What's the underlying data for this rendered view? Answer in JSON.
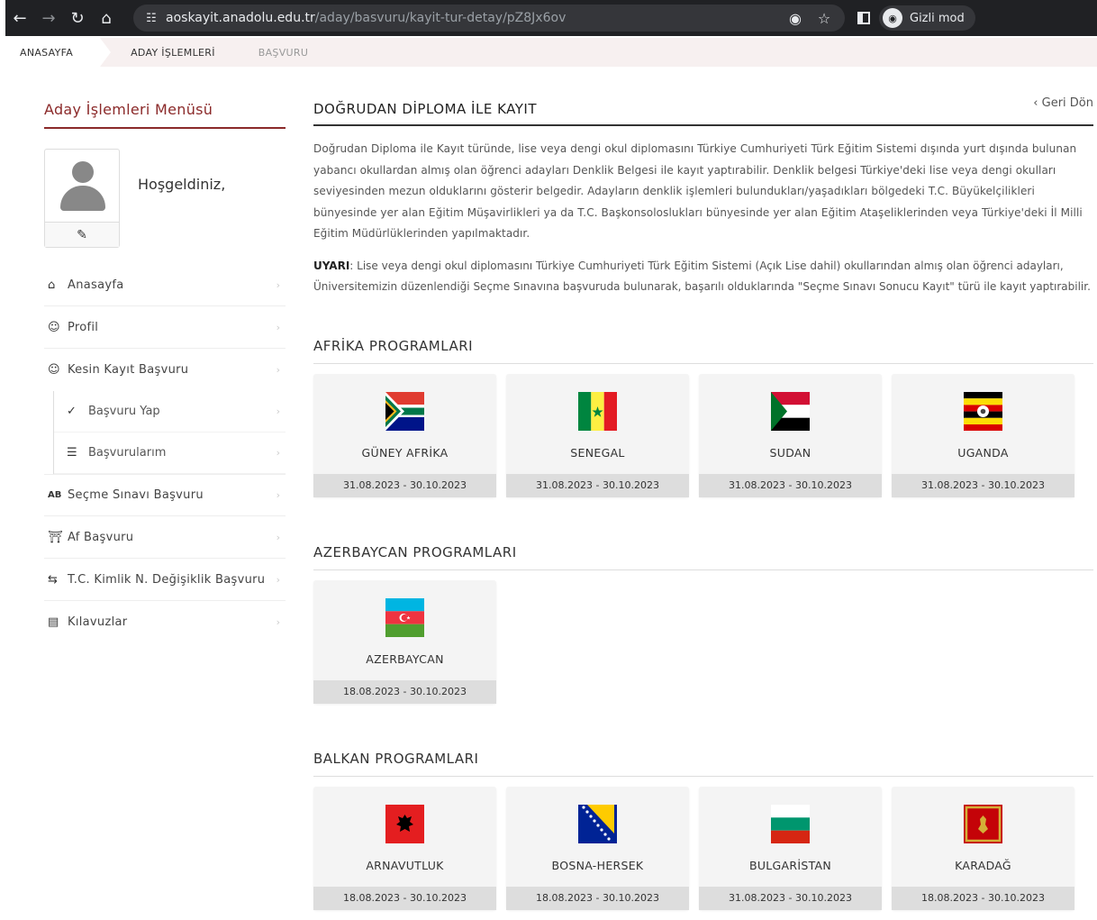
{
  "browser": {
    "url_host": "aoskayit.anadolu.edu.tr",
    "url_path": "/aday/basvuru/kayit-tur-detay/pZ8Jx6ov",
    "incognito_label": "Gizli mod"
  },
  "breadcrumb": [
    "ANASAYFA",
    "ADAY İŞLEMLERİ",
    "BAŞVURU"
  ],
  "sidebar": {
    "title": "Aday İşlemleri Menüsü",
    "welcome": "Hoşgeldiniz,",
    "items": [
      {
        "label": "Anasayfa",
        "icon": "home-icon"
      },
      {
        "label": "Profil",
        "icon": "user-icon"
      },
      {
        "label": "Kesin Kayıt Başvuru",
        "icon": "user-check-icon"
      },
      {
        "label": "Başvuru Yap",
        "icon": "check-icon"
      },
      {
        "label": "Başvurularım",
        "icon": "list-icon"
      },
      {
        "label": "Seçme Sınavı Başvuru",
        "icon": "spellcheck-icon"
      },
      {
        "label": "Af Başvuru",
        "icon": "institution-icon"
      },
      {
        "label": "T.C. Kimlik N. Değişiklik Başvuru",
        "icon": "exchange-icon"
      },
      {
        "label": "Kılavuzlar",
        "icon": "books-icon"
      }
    ]
  },
  "main": {
    "title": "DOĞRUDAN DİPLOMA İLE KAYIT",
    "back": "Geri Dön",
    "description": "Doğrudan Diploma ile Kayıt türünde, lise veya dengi okul diplomasını Türkiye Cumhuriyeti Türk Eğitim Sistemi dışında yurt dışında bulunan yabancı okullardan almış olan öğrenci adayları Denklik Belgesi ile kayıt yaptırabilir. Denklik belgesi Türkiye'deki lise veya dengi okulları seviyesinden mezun olduklarını gösterir belgedir. Adayların denklik işlemleri bulundukları/yaşadıkları bölgedeki T.C. Büyükelçilikleri bünyesinde yer alan Eğitim Müşavirlikleri ya da T.C. Başkonsoloslukları bünyesinde yer alan Eğitim Ataşeliklerinden veya Türkiye'deki İl Milli Eğitim Müdürlüklerinden yapılmaktadır.",
    "warning_label": "UYARI",
    "warning_text": ": Lise veya dengi okul diplomasını Türkiye Cumhuriyeti Türk Eğitim Sistemi (Açık Lise dahil) okullarından almış olan öğrenci adayları, Üniversitemizin düzenlendiği Seçme Sınavına başvuruda bulunarak, başarılı olduklarında \"Seçme Sınavı Sonucu Kayıt\" türü ile kayıt yaptırabilir."
  },
  "sections": [
    {
      "title": "AFRİKA PROGRAMLARI",
      "cards": [
        {
          "name": "GÜNEY AFRİKA",
          "dates": "31.08.2023 - 30.10.2023",
          "flag": "south-africa"
        },
        {
          "name": "SENEGAL",
          "dates": "31.08.2023 - 30.10.2023",
          "flag": "senegal"
        },
        {
          "name": "SUDAN",
          "dates": "31.08.2023 - 30.10.2023",
          "flag": "sudan"
        },
        {
          "name": "UGANDA",
          "dates": "31.08.2023 - 30.10.2023",
          "flag": "uganda"
        }
      ]
    },
    {
      "title": "AZERBAYCAN PROGRAMLARI",
      "cards": [
        {
          "name": "AZERBAYCAN",
          "dates": "18.08.2023 - 30.10.2023",
          "flag": "azerbaijan"
        }
      ]
    },
    {
      "title": "BALKAN PROGRAMLARI",
      "cards": [
        {
          "name": "ARNAVUTLUK",
          "dates": "18.08.2023 - 30.10.2023",
          "flag": "albania"
        },
        {
          "name": "BOSNA-HERSEK",
          "dates": "18.08.2023 - 30.10.2023",
          "flag": "bosnia"
        },
        {
          "name": "BULGARİSTAN",
          "dates": "31.08.2023 - 30.10.2023",
          "flag": "bulgaria"
        },
        {
          "name": "KARADAĞ",
          "dates": "18.08.2023 - 30.10.2023",
          "flag": "montenegro"
        }
      ]
    }
  ],
  "colors": {
    "accent": "#8b2a2a",
    "browser_dark": "#202124",
    "card_bg": "#f4f4f4",
    "date_bar": "#dddddd"
  }
}
